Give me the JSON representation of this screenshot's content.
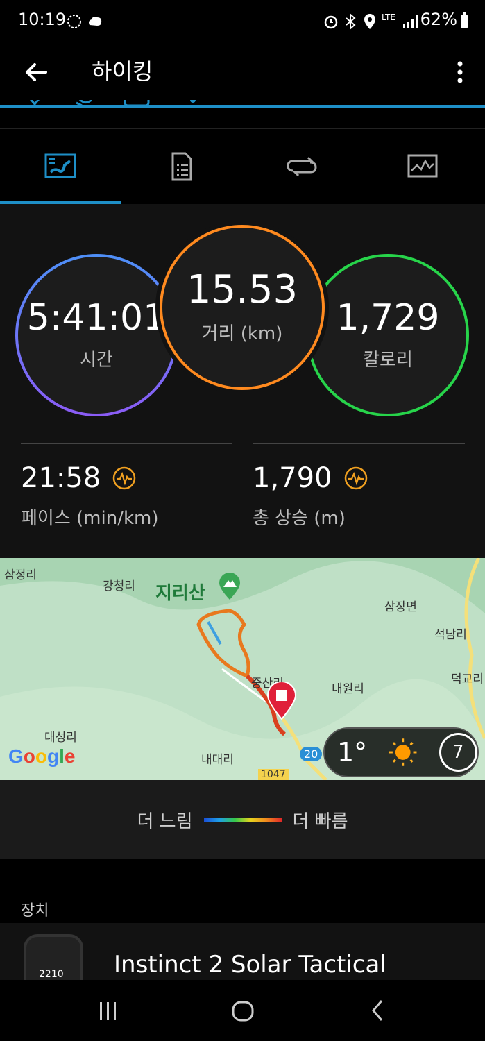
{
  "status_bar": {
    "time": "10:19",
    "battery_percent": "62%",
    "network": "LTE"
  },
  "app_bar": {
    "title": "하이킹"
  },
  "tabs": [
    {
      "name": "map-tab",
      "icon": "map-icon",
      "selected": true
    },
    {
      "name": "details-tab",
      "icon": "document-icon",
      "selected": false
    },
    {
      "name": "laps-tab",
      "icon": "loop-icon",
      "selected": false
    },
    {
      "name": "charts-tab",
      "icon": "chart-icon",
      "selected": false
    }
  ],
  "stats": {
    "time": {
      "value": "5:41:01",
      "label": "시간"
    },
    "distance": {
      "value": "15.53",
      "label": "거리 (km)"
    },
    "calories": {
      "value": "1,729",
      "label": "칼로리"
    },
    "pace": {
      "value": "21:58",
      "label": "페이스 (min/km)"
    },
    "ascent": {
      "value": "1,790",
      "label": "총 상승 (m)"
    }
  },
  "map": {
    "places": [
      "삼정리",
      "강청리",
      "지리산",
      "삼장면",
      "석남리",
      "내원리",
      "덕교리",
      "중산리",
      "대성리",
      "내대리"
    ],
    "road_numbers": [
      "20",
      "1047"
    ],
    "logo": "Google",
    "weather": {
      "temperature": "1°",
      "icon": "sun-icon",
      "moon_day": "7"
    }
  },
  "legend": {
    "slow": "더 느림",
    "fast": "더 빠름"
  },
  "device": {
    "section_label": "장치",
    "name": "Instinct 2 Solar Tactical",
    "watch_time": "2210"
  },
  "colors": {
    "accent": "#1e8fc7",
    "time_ring": "#4e8ff7",
    "distance_ring": "#ff8a1f",
    "calorie_ring": "#27d44a"
  }
}
